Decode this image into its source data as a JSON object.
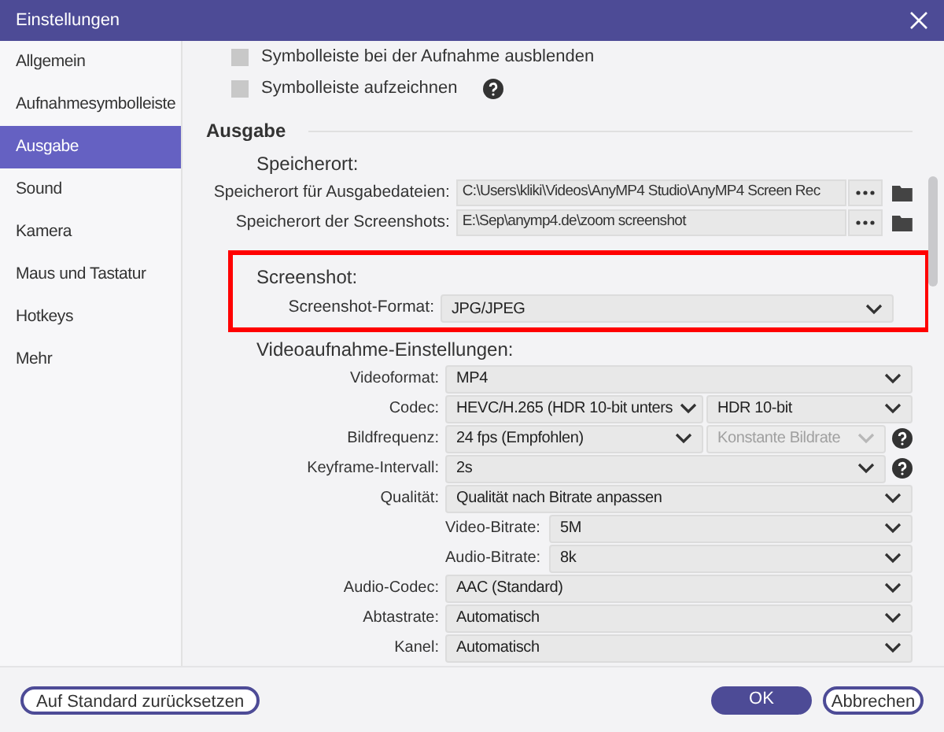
{
  "window": {
    "title": "Einstellungen"
  },
  "sidebar": {
    "items": [
      {
        "label": "Allgemein",
        "selected": false
      },
      {
        "label": "Aufnahmesymbolleiste",
        "selected": false
      },
      {
        "label": "Ausgabe",
        "selected": true
      },
      {
        "label": "Sound",
        "selected": false
      },
      {
        "label": "Kamera",
        "selected": false
      },
      {
        "label": "Maus und Tastatur",
        "selected": false
      },
      {
        "label": "Hotkeys",
        "selected": false
      },
      {
        "label": "Mehr",
        "selected": false
      }
    ]
  },
  "toolbar_options": [
    {
      "label": "Symbolleiste bei der Aufnahme ausblenden",
      "checked": false,
      "help": false
    },
    {
      "label": "Symbolleiste aufzeichnen",
      "checked": false,
      "help": true
    }
  ],
  "output": {
    "heading": "Ausgabe",
    "location": {
      "heading": "Speicherort:",
      "rows": [
        {
          "label": "Speicherort für Ausgabedateien:",
          "value": "C:\\Users\\kliki\\Videos\\AnyMP4 Studio\\AnyMP4 Screen Rec"
        },
        {
          "label": "Speicherort der Screenshots:",
          "value": "E:\\Sep\\anymp4.de\\zoom screenshot"
        }
      ]
    },
    "screenshot": {
      "heading": "Screenshot:",
      "highlighted": true,
      "label": "Screenshot-Format:",
      "value": "JPG/JPEG"
    },
    "video": {
      "heading": "Videoaufnahme-Einstellungen:",
      "rows": [
        {
          "kind": "main",
          "label": "Videoformat:",
          "fields": [
            {
              "value": "MP4",
              "disabled": false
            }
          ],
          "help": false
        },
        {
          "kind": "main",
          "label": "Codec:",
          "fields": [
            {
              "value": "HEVC/H.265 (HDR 10-bit unters",
              "disabled": false
            },
            {
              "value": "HDR 10-bit",
              "disabled": false
            }
          ],
          "help": false
        },
        {
          "kind": "main",
          "label": "Bildfrequenz:",
          "fields": [
            {
              "value": "24 fps (Empfohlen)",
              "disabled": false
            },
            {
              "value": "Konstante Bildrate",
              "disabled": true
            }
          ],
          "help": true
        },
        {
          "kind": "main",
          "label": "Keyframe-Intervall:",
          "fields": [
            {
              "value": "2s",
              "disabled": false
            }
          ],
          "help": true
        },
        {
          "kind": "main",
          "label": "Qualität:",
          "fields": [
            {
              "value": "Qualität nach Bitrate anpassen",
              "disabled": false
            }
          ],
          "help": false
        },
        {
          "kind": "sub",
          "label": "Video-Bitrate:",
          "fields": [
            {
              "value": "5M",
              "disabled": false
            }
          ],
          "help": false
        },
        {
          "kind": "sub",
          "label": "Audio-Bitrate:",
          "fields": [
            {
              "value": "8k",
              "disabled": false
            }
          ],
          "help": false
        },
        {
          "kind": "main",
          "label": "Audio-Codec:",
          "fields": [
            {
              "value": "AAC (Standard)",
              "disabled": false
            }
          ],
          "help": false
        },
        {
          "kind": "main",
          "label": "Abtastrate:",
          "fields": [
            {
              "value": "Automatisch",
              "disabled": false
            }
          ],
          "help": false
        },
        {
          "kind": "main",
          "label": "Kanel:",
          "fields": [
            {
              "value": "Automatisch",
              "disabled": false
            }
          ],
          "help": false
        }
      ]
    }
  },
  "footer": {
    "reset_button": "Auf Standard zurücksetzen",
    "ok_button": "OK",
    "cancel_button": "Abbrechen"
  }
}
